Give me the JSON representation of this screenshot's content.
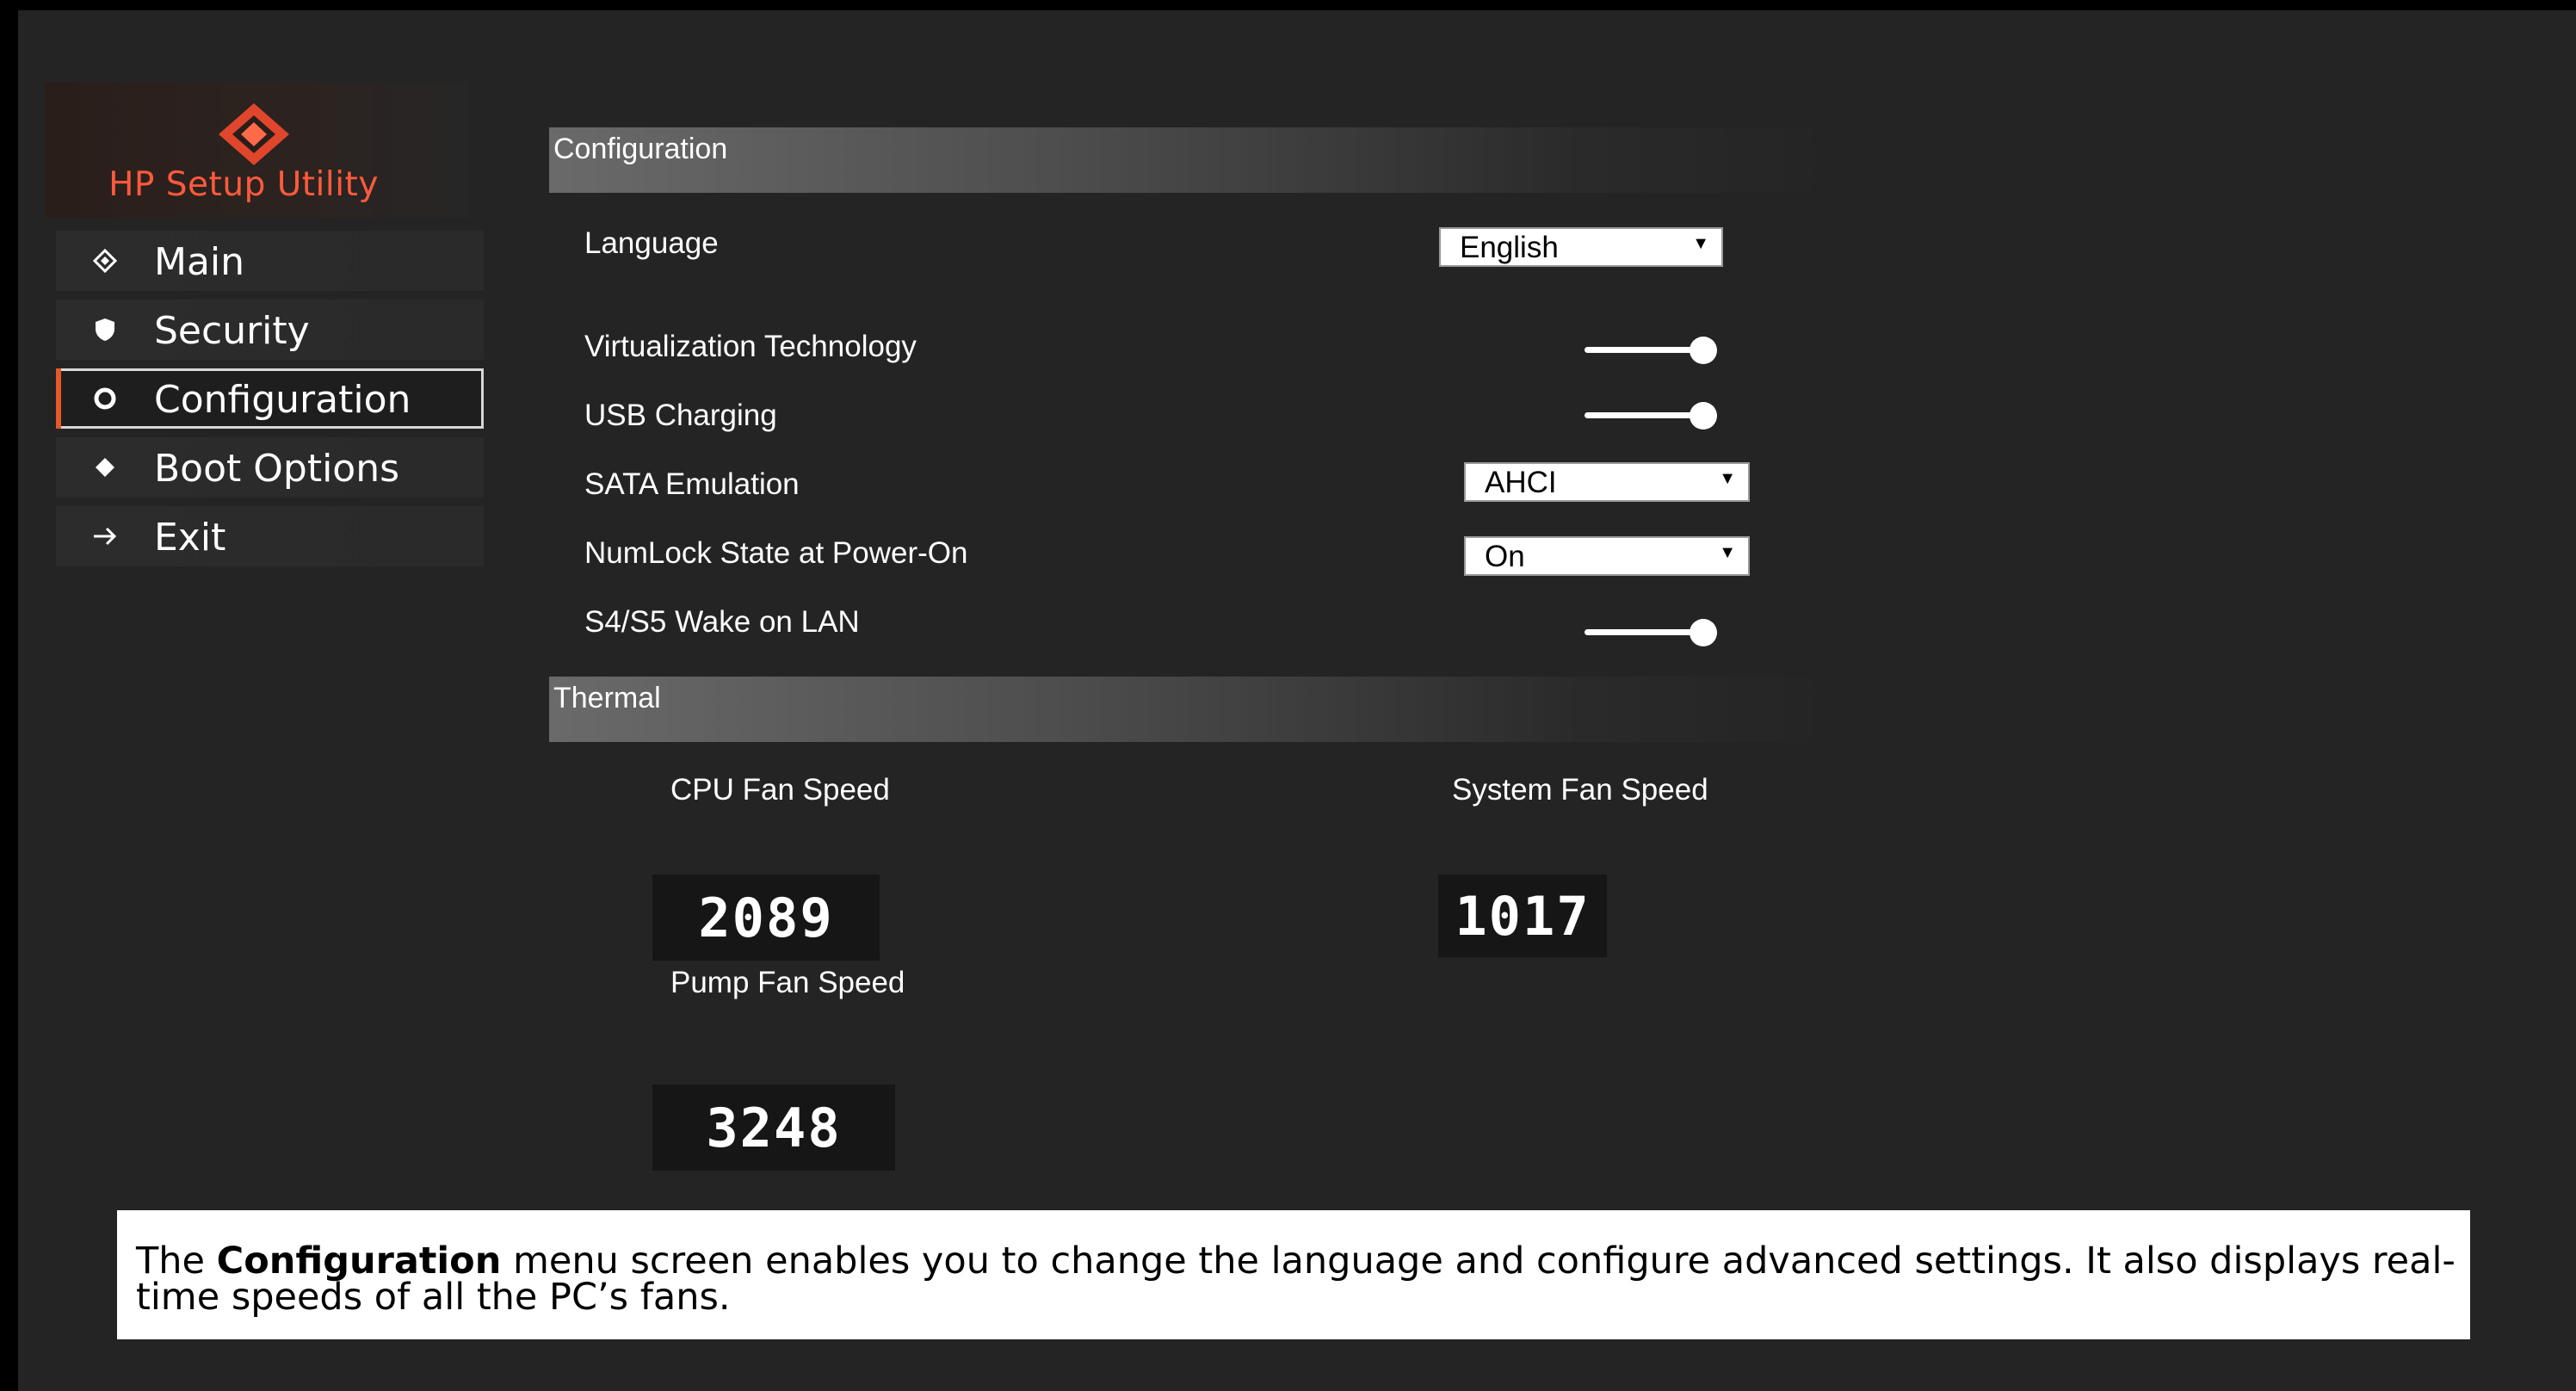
{
  "app": {
    "title": "HP Setup Utility"
  },
  "sidebar": {
    "items": [
      {
        "label": "Main",
        "icon": "diamond-icon",
        "active": false
      },
      {
        "label": "Security",
        "icon": "shield-icon",
        "active": false
      },
      {
        "label": "Configuration",
        "icon": "gear-icon",
        "active": true
      },
      {
        "label": "Boot Options",
        "icon": "diamond-filled-icon",
        "active": false
      },
      {
        "label": "Exit",
        "icon": "arrow-right-icon",
        "active": false
      }
    ]
  },
  "main": {
    "configuration": {
      "header": "Configuration",
      "language": {
        "label": "Language",
        "value": "English"
      },
      "virtualization": {
        "label": "Virtualization Technology",
        "enabled": true
      },
      "usb_charging": {
        "label": "USB Charging",
        "enabled": true
      },
      "sata": {
        "label": "SATA Emulation",
        "value": "AHCI"
      },
      "numlock": {
        "label": "NumLock State at  Power-On",
        "value": "On"
      },
      "wake_on_lan": {
        "label": "S4/S5 Wake on LAN",
        "enabled": true
      }
    },
    "thermal": {
      "header": "Thermal",
      "cpu_fan": {
        "label": "CPU Fan Speed",
        "value": "2089"
      },
      "system_fan": {
        "label": "System Fan Speed",
        "value": "1017"
      },
      "pump_fan": {
        "label": "Pump Fan Speed",
        "value": "3248"
      }
    }
  },
  "caption": {
    "prefix": "The ",
    "bold": "Configuration",
    "suffix": " menu screen enables you to change the language and configure advanced settings. It also displays real-time speeds of all the PC’s fans."
  },
  "colors": {
    "accent": "#e35a28",
    "logo": "#ff5a3c",
    "background": "#242424"
  }
}
